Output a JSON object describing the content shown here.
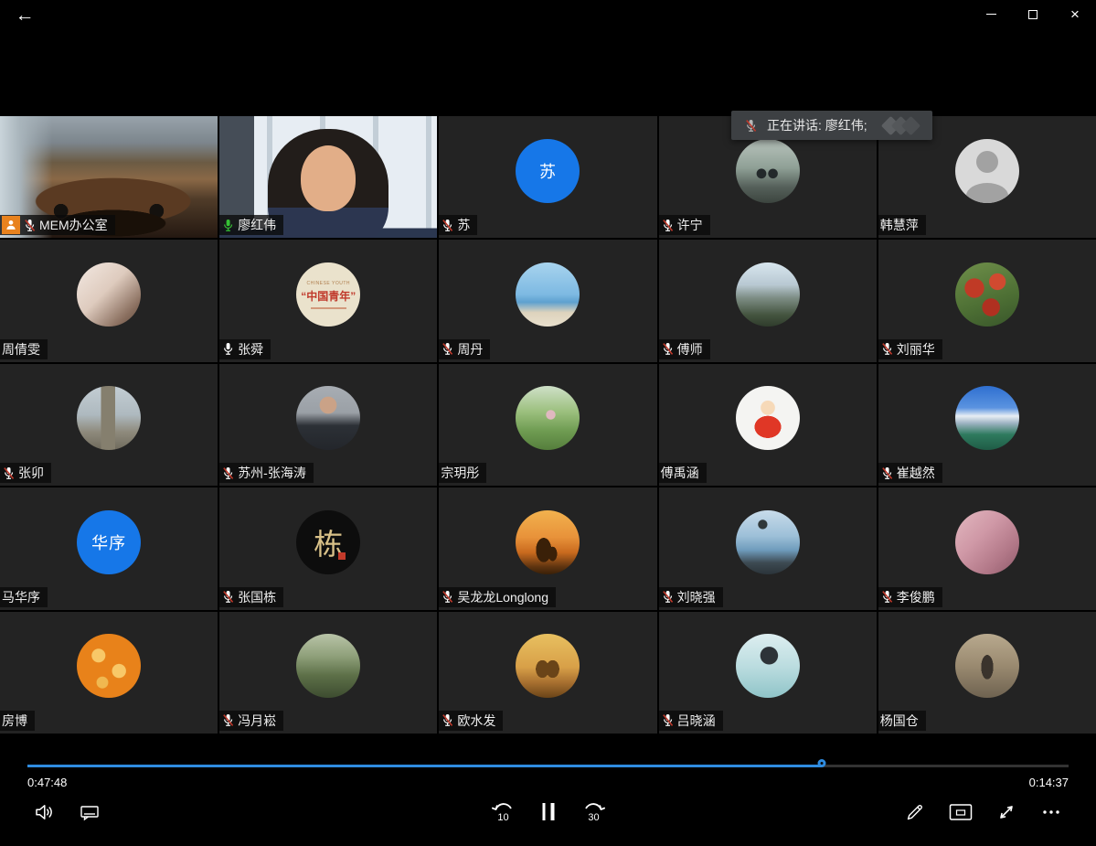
{
  "window": {
    "back_icon": "←",
    "close_glyph": "×"
  },
  "tooltip": {
    "speaking_label": "正在讲话: 廖红伟;"
  },
  "meeting": {
    "participants": [
      {
        "name": "MEM办公室",
        "mic": "muted",
        "badge": "person",
        "scene": "meeting-room"
      },
      {
        "name": "廖红伟",
        "mic": "active",
        "speaking": true,
        "scene": "speaker"
      },
      {
        "name": "苏",
        "mic": "muted",
        "avatar": {
          "kind": "letter",
          "text": "苏"
        }
      },
      {
        "name": "许宁",
        "mic": "muted",
        "avatar": {
          "kind": "photo",
          "style": "bench-couple"
        }
      },
      {
        "name": "韩慧萍",
        "mic": "none",
        "avatar": {
          "kind": "default"
        }
      },
      {
        "name": "周倩雯",
        "mic": "none",
        "avatar": {
          "kind": "photo",
          "style": "portrait-light"
        }
      },
      {
        "name": "张舜",
        "mic": "active_white",
        "avatar": {
          "kind": "badge",
          "text": "“中国青年”",
          "subtext": "CHINESE YOUTH"
        }
      },
      {
        "name": "周丹",
        "mic": "muted",
        "avatar": {
          "kind": "photo",
          "style": "beach"
        }
      },
      {
        "name": "傅师",
        "mic": "muted",
        "avatar": {
          "kind": "photo",
          "style": "mountain-pines"
        }
      },
      {
        "name": "刘丽华",
        "mic": "muted",
        "avatar": {
          "kind": "photo",
          "style": "red-flowers"
        }
      },
      {
        "name": "张卯",
        "mic": "muted",
        "avatar": {
          "kind": "photo",
          "style": "stone-tower"
        }
      },
      {
        "name": "苏州-张海涛",
        "mic": "muted",
        "avatar": {
          "kind": "photo",
          "style": "man-portrait"
        }
      },
      {
        "name": "宗玥彤",
        "mic": "none",
        "avatar": {
          "kind": "photo",
          "style": "park-green"
        }
      },
      {
        "name": "傅禹涵",
        "mic": "none",
        "avatar": {
          "kind": "photo",
          "style": "cartoon-red-kid"
        }
      },
      {
        "name": "崔越然",
        "mic": "muted",
        "avatar": {
          "kind": "photo",
          "style": "alpine-lake"
        }
      },
      {
        "name": "马华序",
        "mic": "none",
        "avatar": {
          "kind": "letter",
          "text": "华序"
        }
      },
      {
        "name": "张国栋",
        "mic": "muted",
        "avatar": {
          "kind": "calligraphy",
          "text": "栋"
        }
      },
      {
        "name": "吴龙龙Longlong",
        "mic": "muted",
        "avatar": {
          "kind": "photo",
          "style": "sunset-father-child"
        }
      },
      {
        "name": "刘晓强",
        "mic": "muted",
        "avatar": {
          "kind": "photo",
          "style": "sea-bird"
        }
      },
      {
        "name": "李俊鹏",
        "mic": "muted",
        "avatar": {
          "kind": "photo",
          "style": "pink-scene"
        }
      },
      {
        "name": "房博",
        "mic": "none",
        "avatar": {
          "kind": "photo",
          "style": "orange-swirl"
        }
      },
      {
        "name": "冯月崧",
        "mic": "muted",
        "avatar": {
          "kind": "photo",
          "style": "garden"
        }
      },
      {
        "name": "欧水发",
        "mic": "muted",
        "avatar": {
          "kind": "photo",
          "style": "sunset-couple"
        }
      },
      {
        "name": "吕晓涵",
        "mic": "muted",
        "avatar": {
          "kind": "photo",
          "style": "teal-portrait"
        }
      },
      {
        "name": "杨国仓",
        "mic": "none",
        "avatar": {
          "kind": "photo",
          "style": "outdoor-person"
        }
      }
    ]
  },
  "player": {
    "elapsed": "0:47:48",
    "remaining": "0:14:37",
    "progress_percent": 76.3,
    "skip_back_label": "10",
    "skip_forward_label": "30"
  },
  "colors": {
    "accent_blue": "#1677e8",
    "speaking_green": "#1f8a35",
    "progress_blue": "#2f8ce0",
    "badge_orange": "#e8821e",
    "mute_red": "#c0392b",
    "active_mic_green": "#35c135",
    "tile_bg": "#232323",
    "tooltip_bg": "#3d4043"
  }
}
